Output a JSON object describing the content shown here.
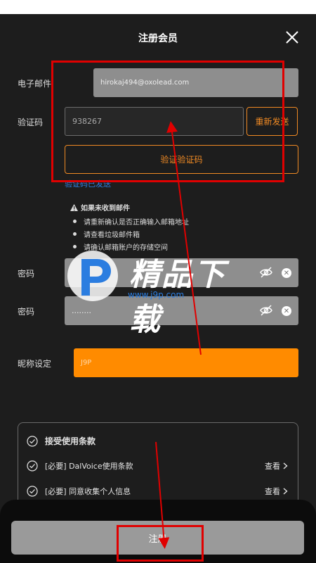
{
  "header": {
    "title": "注册会员"
  },
  "form": {
    "email_label": "电子邮件",
    "email_value": "hirokaj494@oxolead.com",
    "code_label": "验证码",
    "code_value": "938267",
    "resend_label": "重新发送",
    "verify_label": "验证验证码",
    "code_sent_text": "验证码已发送",
    "password_label": "密码",
    "password2_label": "密码",
    "password_mask": "........",
    "nickname_label": "昵称设定",
    "nickname_value": "J9P"
  },
  "notice": {
    "title": "如果未收到邮件",
    "tips": [
      "请重新确认是否正确输入邮箱地址",
      "请查看垃圾邮件箱",
      "请确认邮箱账户的存储空间"
    ]
  },
  "terms": {
    "accept_all": "接受使用条款",
    "items": [
      {
        "label": "[必要] DalVoice使用条款",
        "action": "查看"
      },
      {
        "label": "[必要] 同意收集个人信息",
        "action": "查看"
      }
    ]
  },
  "register_label": "注册",
  "watermark": {
    "text": "精品下载",
    "url": "www.j9p.com"
  },
  "colors": {
    "background": "#1d1d1d",
    "accent": "#ff8b00",
    "annotation": "#e00000",
    "link": "#2f7fe0"
  }
}
